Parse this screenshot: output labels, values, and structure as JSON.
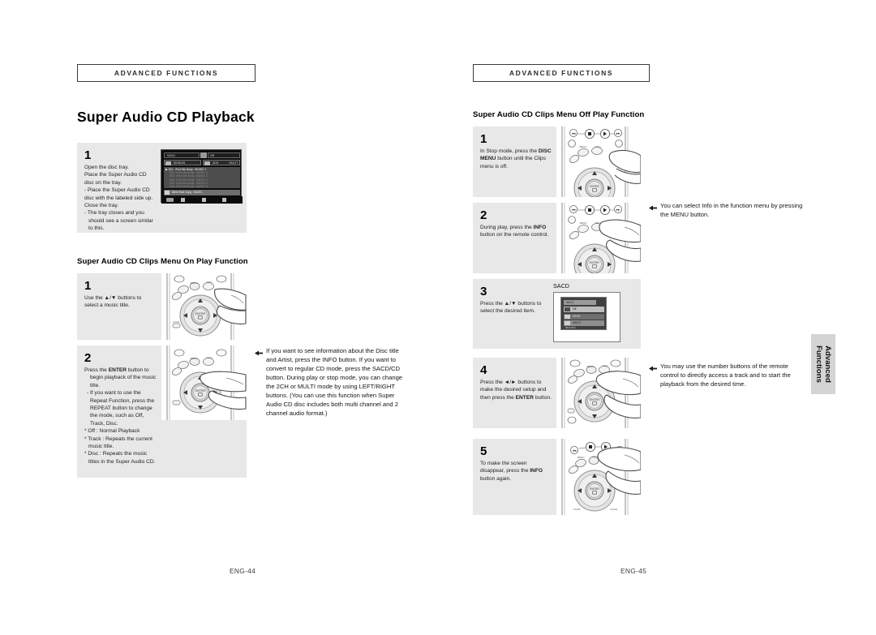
{
  "document": {
    "left_page": {
      "section_header": "Advanced Functions",
      "title": "Super Audio CD Playback",
      "folio": "ENG-44",
      "step1": {
        "number": "1",
        "lines": [
          "Open the disc tray.",
          "Place the Super Audio CD",
          "disc on the tray.",
          "- Place the Super Audio CD",
          "disc with the labeled side up.",
          "Close the tray.",
          "- The tray closes and you",
          "should see a screen similar",
          "to this."
        ]
      },
      "sub_heading": "Super Audio CD Clips Menu On Play Function",
      "step_on_1": {
        "number": "1",
        "text": "Use the ▲/▼ buttons to select a music title."
      },
      "step_on_2": {
        "number": "2",
        "lines": [
          "Press the ENTER button to begin playback of the music title.",
          "- If you want to use the Repeat Function, press the REPEAT button to change the mode, such as Off, Track, Disc.",
          "* Off : Normal Playback",
          "* Track : Repeats the current music title.",
          "* Disc : Repeats the music titles in the Super Audio CD."
        ]
      },
      "note": "If you want to see information about the Disc title and Artist, press the INFO button. If you want to convert to regular CD mode, press the SACD/CD button. During play or stop mode, you can change the 2CH or MULTI mode by using LEFT/RIGHT buttons. (You can use this function when Super Audio CD disc includes both multi channel and 2 channel audio format.)"
    },
    "right_page": {
      "section_header": "Advanced Functions",
      "sub_heading": "Super Audio CD Clips Menu Off Play Function",
      "folio": "ENG-45",
      "step1": {
        "number": "1",
        "text": "In Stop mode, press the DISC MENU button until the Clips menu is off."
      },
      "step2": {
        "number": "2",
        "text": "During play, press the INFO button on the remote control."
      },
      "note2": "You can select Info in the function menu by pressing the MENU button.",
      "step3": {
        "number": "3",
        "text": "Press the ▲/▼ buttons to select the desired item."
      },
      "sacd_label": "SACD",
      "step4": {
        "number": "4",
        "text": "Press the ◄/► buttons to make the desired setup and then press the ENTER button."
      },
      "note4": "You may use the number buttons of the remote control to directly access a track and to start the playback from the desired time.",
      "step5": {
        "number": "5",
        "text": "To make the screen disappear, press the INFO button again."
      }
    },
    "side_tab": {
      "line1": "Advanced",
      "line2": "Functions"
    },
    "osd_disc": {
      "tag": "SACD",
      "mode": "Off",
      "time": "00:00:23",
      "channel": "2CH",
      "multi": "MULTI",
      "tracks": [
        "001 : iPod Mix Body : MUSIC 1",
        "002 : iPod Mix Body : MUSIC 2",
        "003 : iPod Mix Body : MUSIC 3",
        "004 : iPod Mix Body : MUSIC 4",
        "005 : iPod Mix Body : MUSIC 5",
        "006 : iPod Mix Body : MUSIC 6"
      ],
      "footer_title": "Mem Sub Copy : SACD -",
      "buttons": [
        "ENTER",
        "SETUP",
        "EXIT"
      ]
    },
    "osd_sacd": {
      "title": "SACD",
      "rows": [
        "Off",
        "2CH/1",
        "MULTI"
      ],
      "footer": "RETURN"
    },
    "colors": {
      "panel_bg": "#e8e8e8",
      "tab_bg": "#d4d4d4",
      "osd_bg": "#0b0b0b",
      "osd_highlight": "#b8b8b8",
      "text": "#1a1a1a"
    }
  }
}
